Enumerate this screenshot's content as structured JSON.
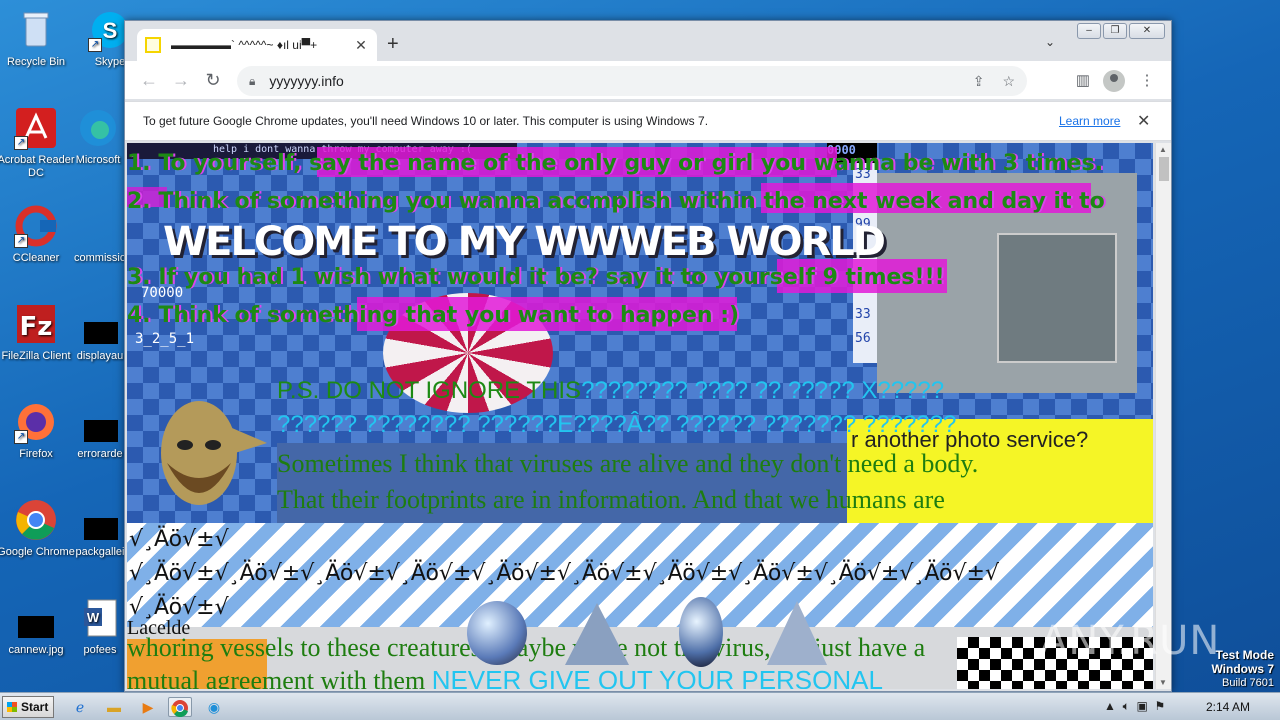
{
  "desktop": {
    "icons": [
      {
        "label": "Recycle Bin",
        "icon": "recycle-bin-icon",
        "color": "#9fb7d6"
      },
      {
        "label": "Skype",
        "icon": "skype-icon",
        "color": "#00aff0"
      },
      {
        "label": "Acrobat Reader DC",
        "icon": "acrobat-icon",
        "color": "#d31f1f"
      },
      {
        "label": "Microsoft",
        "icon": "edge-icon",
        "color": "#1f8fd8"
      },
      {
        "label": "CCleaner",
        "icon": "ccleaner-icon",
        "color": "#d9302a"
      },
      {
        "label": "commissio",
        "icon": "file-icon",
        "color": "#111111"
      },
      {
        "label": "FileZilla Client",
        "icon": "filezilla-icon",
        "color": "#bf1f1f"
      },
      {
        "label": "displayau",
        "icon": "file-icon",
        "color": "#111111"
      },
      {
        "label": "Firefox",
        "icon": "firefox-icon",
        "color": "#ff7139"
      },
      {
        "label": "errorarde",
        "icon": "file-icon",
        "color": "#111111"
      },
      {
        "label": "Google Chrome",
        "icon": "chrome-icon",
        "color": "#4285f4"
      },
      {
        "label": "packgallei",
        "icon": "file-icon",
        "color": "#111111"
      },
      {
        "label": "cannew.jpg",
        "icon": "image-file-icon",
        "color": "#111111"
      },
      {
        "label": "pofees",
        "icon": "word-icon",
        "color": "#2b579a"
      }
    ]
  },
  "browser": {
    "tab_title": "▬▬▬▬▬` ^^^^^~ ♦ıl ui▀+",
    "url": "yyyyyyy.info",
    "infobar_message": "To get future Google Chrome updates, you'll need Windows 10 or later. This computer is using Windows 7.",
    "infobar_link": "Learn more"
  },
  "page": {
    "terminal_text": "help i dont wanna throw my computer away :(",
    "lines": [
      "1. To yourself, say the name of the only guy or girl you wanna be with 3 times.",
      "2. Think of something you wanna accmplish within the next week and day it to",
      "3. If you had 1 wish what would it be? say it to yourself 9 times!!!",
      "4. Think of something that you want to happen :)"
    ],
    "welcome": "WELCOME TO MY WWWEB WORLD",
    "numbers": [
      "0000",
      "33",
      "99",
      "70000",
      "33",
      "56",
      "3_2_5_1"
    ],
    "ps_green": "P.S. DO NOT IGNORE THIS",
    "ps_cyan_1": "???????? ???? ?? ????? X?????",
    "ps_cyan_2": "?????? ???????? ??????E????Â?? ?????? ??????? ???????",
    "photo_service": "r another photo service?",
    "serif_1": "Sometimes I think that viruses are alive and they don't need a body.",
    "serif_2": "That their footprints are in information. And that we humans are",
    "sym_1": "√¸Äö√±√",
    "sym_2": "√¸Äö√±√¸Äö√±√¸Äö√±√¸Äö√±√¸Äö√±√¸Äö√±√¸Äö√±√¸Äö√±√¸Äö√±√¸Äö√±√",
    "sym_3": "√¸Äö√±√",
    "lacelde": "Lacelde",
    "bottom_1": "whoring vessels to these creatures. Maybe we're not the virus, we just have a",
    "bottom_2": "mutual agreement with them",
    "never_give": "NEVER GIVE OUT YOUR PERSONAL"
  },
  "taskbar": {
    "start": "Start",
    "clock": "2:14 AM"
  },
  "watermark": {
    "line1": "Test Mode",
    "line2": "Windows 7",
    "line3": "Build 7601",
    "brand": "ANY.RUN"
  }
}
